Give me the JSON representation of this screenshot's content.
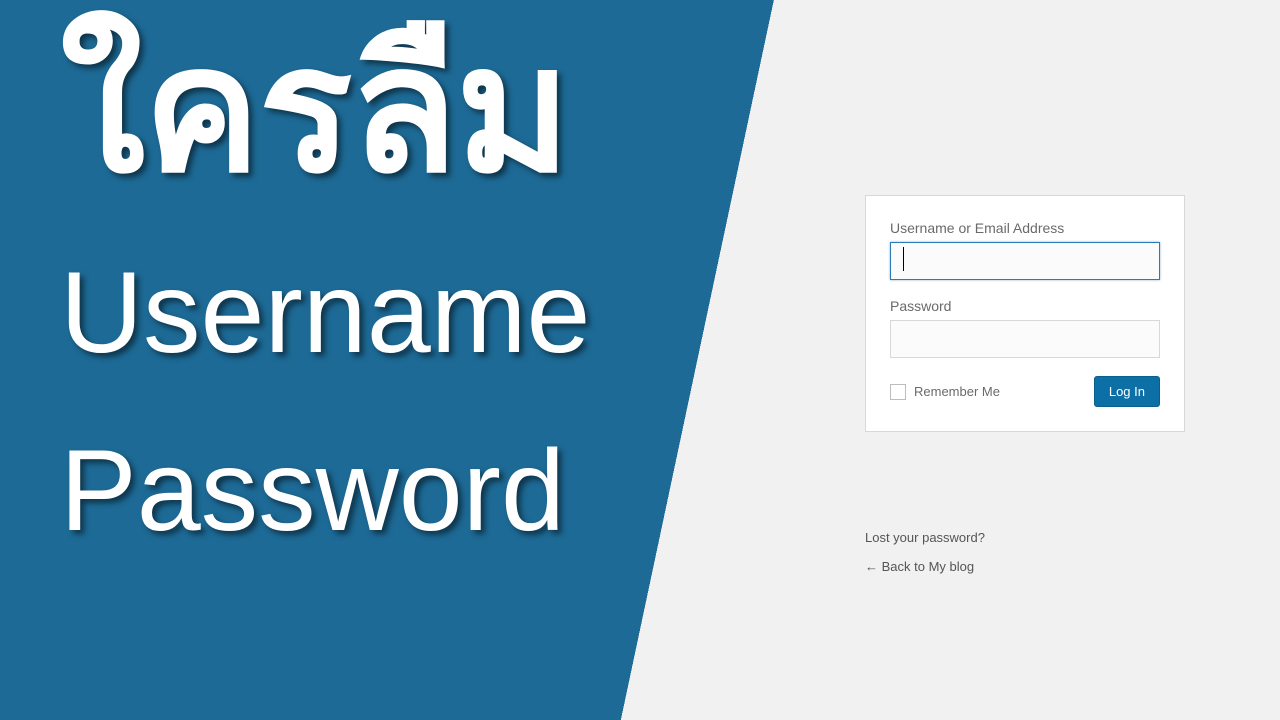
{
  "headline": {
    "line1": "ใครลืม",
    "line2": "Username",
    "line3": "Password"
  },
  "login_form": {
    "username_label": "Username or Email Address",
    "username_value": "",
    "password_label": "Password",
    "password_value": "",
    "remember_me_label": "Remember Me",
    "login_button_label": "Log In"
  },
  "links": {
    "lost_password": "Lost your password?",
    "back_to_blog": "← Back to My blog"
  }
}
